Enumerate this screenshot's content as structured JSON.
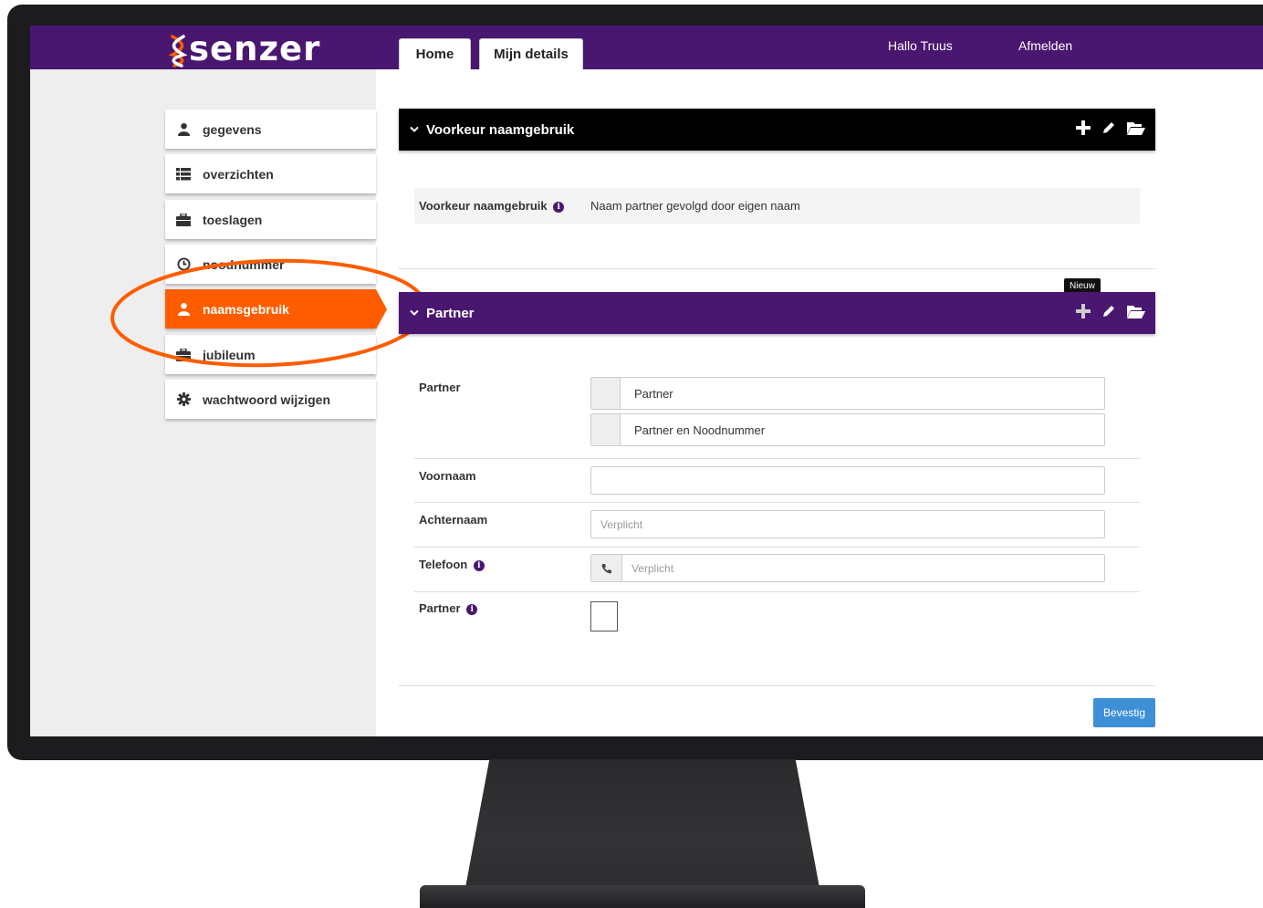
{
  "app": {
    "logo_text": "senzer"
  },
  "header": {
    "tabs": [
      {
        "label": "Home"
      },
      {
        "label": "Mijn details"
      }
    ],
    "greeting": "Hallo Truus",
    "logout": "Afmelden"
  },
  "sidebar": {
    "items": [
      {
        "label": "gegevens",
        "icon": "user-icon"
      },
      {
        "label": "overzichten",
        "icon": "list-icon"
      },
      {
        "label": "toeslagen",
        "icon": "briefcase-icon"
      },
      {
        "label": "noodnummer",
        "icon": "clock-icon"
      },
      {
        "label": "naamsgebruik",
        "icon": "user-icon",
        "active": true
      },
      {
        "label": "jubileum",
        "icon": "briefcase-icon"
      },
      {
        "label": "wachtwoord wijzigen",
        "icon": "gear-icon"
      }
    ]
  },
  "panel_preference": {
    "title": "Voorkeur naamgebruik",
    "label": "Voorkeur naamgebruik",
    "value": "Naam partner gevolgd door eigen naam"
  },
  "panel_partner": {
    "title": "Partner",
    "tooltip": "Nieuw",
    "partner_label": "Partner",
    "partner_options": [
      "Partner",
      "Partner en Noodnummer"
    ],
    "first_name_label": "Voornaam",
    "first_name_value": "",
    "last_name_label": "Achternaam",
    "last_name_placeholder": "Verplicht",
    "phone_label": "Telefoon",
    "phone_placeholder": "Verplicht",
    "partner_checkbox_label": "Partner",
    "partner_checked": false,
    "confirm_button": "Bevestig"
  },
  "colors": {
    "brand_purple": "#4a1770",
    "accent_orange": "#ff5c00",
    "header_black": "#000000",
    "button_blue": "#3d8fd6"
  }
}
